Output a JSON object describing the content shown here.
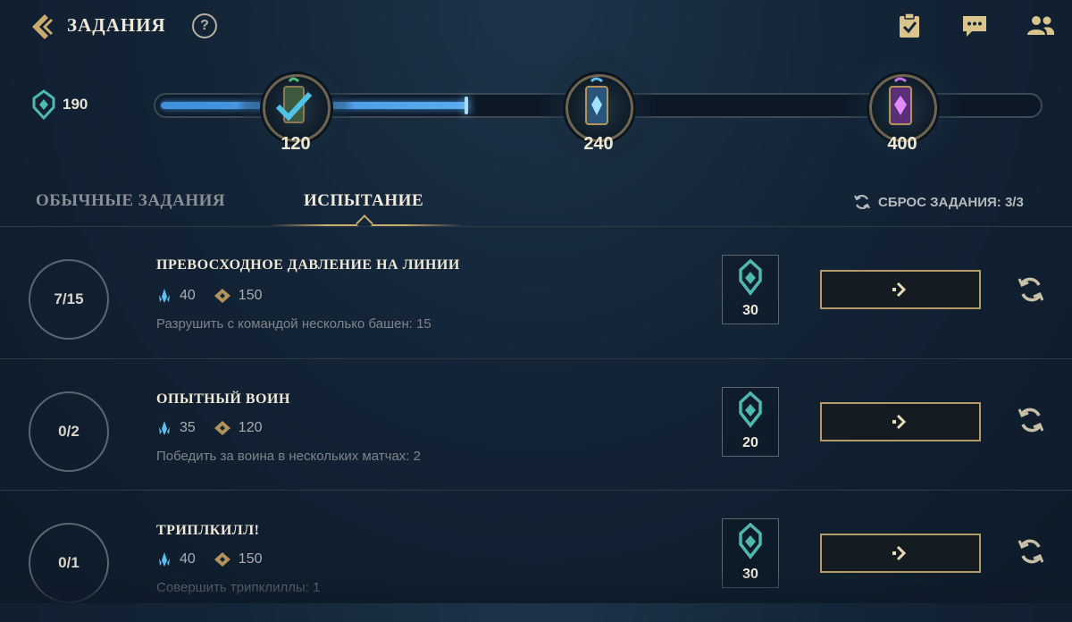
{
  "header": {
    "title": "ЗАДАНИЯ",
    "help_label": "?",
    "icons": [
      "back-chevron-icon",
      "clipboard-check-icon",
      "chat-bubble-icon",
      "friends-icon"
    ]
  },
  "progress": {
    "points": "190",
    "fill_percent": 35,
    "milestones": [
      {
        "value": "120",
        "completed": true,
        "icon": "green-reward-capsule-icon"
      },
      {
        "value": "240",
        "completed": false,
        "icon": "blue-reward-capsule-icon"
      },
      {
        "value": "400",
        "completed": false,
        "icon": "purple-reward-capsule-icon"
      }
    ]
  },
  "tabs": {
    "normal": "ОБЫЧНЫЕ ЗАДАНИЯ",
    "challenge": "ИСПЫТАНИЕ",
    "active": "challenge"
  },
  "reset": {
    "label": "СБРОС ЗАДАНИЯ: 3/3"
  },
  "quests": [
    {
      "progress": "7/15",
      "title": "ПРЕВОСХОДНОЕ ДАВЛЕНИЕ НА ЛИНИИ",
      "reward_blue": "40",
      "reward_gold": "150",
      "description": "Разрушить с командой несколько башен: 15",
      "badge_points": "30"
    },
    {
      "progress": "0/2",
      "title": "ОПЫТНЫЙ ВОИН",
      "reward_blue": "35",
      "reward_gold": "120",
      "description": "Победить за воина в нескольких матчах: 2",
      "badge_points": "20"
    },
    {
      "progress": "0/1",
      "title": "ТРИПЛКИЛЛ!",
      "reward_blue": "40",
      "reward_gold": "150",
      "description": "Совершить трипклиллы: 1",
      "badge_points": "30"
    }
  ],
  "colors": {
    "accent_gold": "#c8aa6e",
    "accent_blue": "#4a9be0",
    "teal": "#4fb8b0"
  }
}
